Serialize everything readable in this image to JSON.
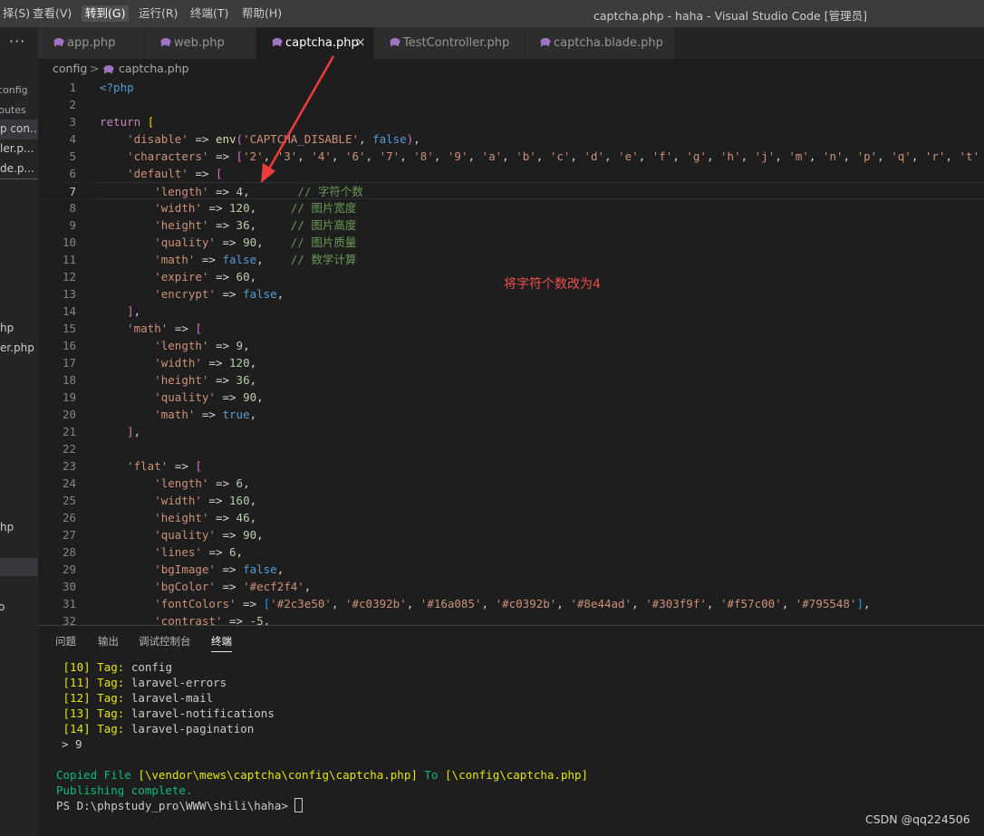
{
  "menu": [
    "择(S)",
    "查看(V)",
    "转到(G)",
    "运行(R)",
    "终端(T)",
    "帮助(H)"
  ],
  "window_title": "captcha.php - haha - Visual Studio Code [管理员]",
  "sidebar": {
    "more": "···",
    "items": [
      "config",
      "routes",
      "p con...",
      "ler.p...",
      "de.p...",
      "hp",
      "er.php",
      "hp",
      "o"
    ]
  },
  "tabs": [
    {
      "label": "app.php"
    },
    {
      "label": "web.php"
    },
    {
      "label": "captcha.php",
      "close": "×"
    },
    {
      "label": "TestController.php"
    },
    {
      "label": "captcha.blade.php"
    }
  ],
  "breadcrumb": {
    "folder": "config",
    "sep": ">",
    "file": "captcha.php"
  },
  "editor": {
    "line_numbers": [
      "1",
      "2",
      "3",
      "4",
      "5",
      "6",
      "7",
      "8",
      "9",
      "10",
      "11",
      "12",
      "13",
      "14",
      "15",
      "16",
      "17",
      "18",
      "19",
      "20",
      "21",
      "22",
      "23",
      "24",
      "25",
      "26",
      "27",
      "28",
      "29",
      "30",
      "31",
      "32"
    ],
    "annotation": "将字符个数改为4"
  },
  "panel": {
    "tabs": [
      "问题",
      "输出",
      "调试控制台",
      "终端"
    ],
    "terminal": {
      "tags": [
        {
          "num": "[10]",
          "label": "Tag:",
          "name": "config"
        },
        {
          "num": "[11]",
          "label": "Tag:",
          "name": "laravel-errors"
        },
        {
          "num": "[12]",
          "label": "Tag:",
          "name": "laravel-mail"
        },
        {
          "num": "[13]",
          "label": "Tag:",
          "name": "laravel-notifications"
        },
        {
          "num": "[14]",
          "label": "Tag:",
          "name": "laravel-pagination"
        }
      ],
      "prompt_answer": "> 9",
      "copied": {
        "a": "Copied File",
        "from": "[\\vendor\\mews\\captcha\\config\\captcha.php]",
        "to": "To",
        "dest": "[\\config\\captcha.php]"
      },
      "publishing": "Publishing complete.",
      "ps": "PS D:\\phpstudy_pro\\WWW\\shili\\haha> "
    }
  },
  "watermark": "CSDN @qq224506"
}
